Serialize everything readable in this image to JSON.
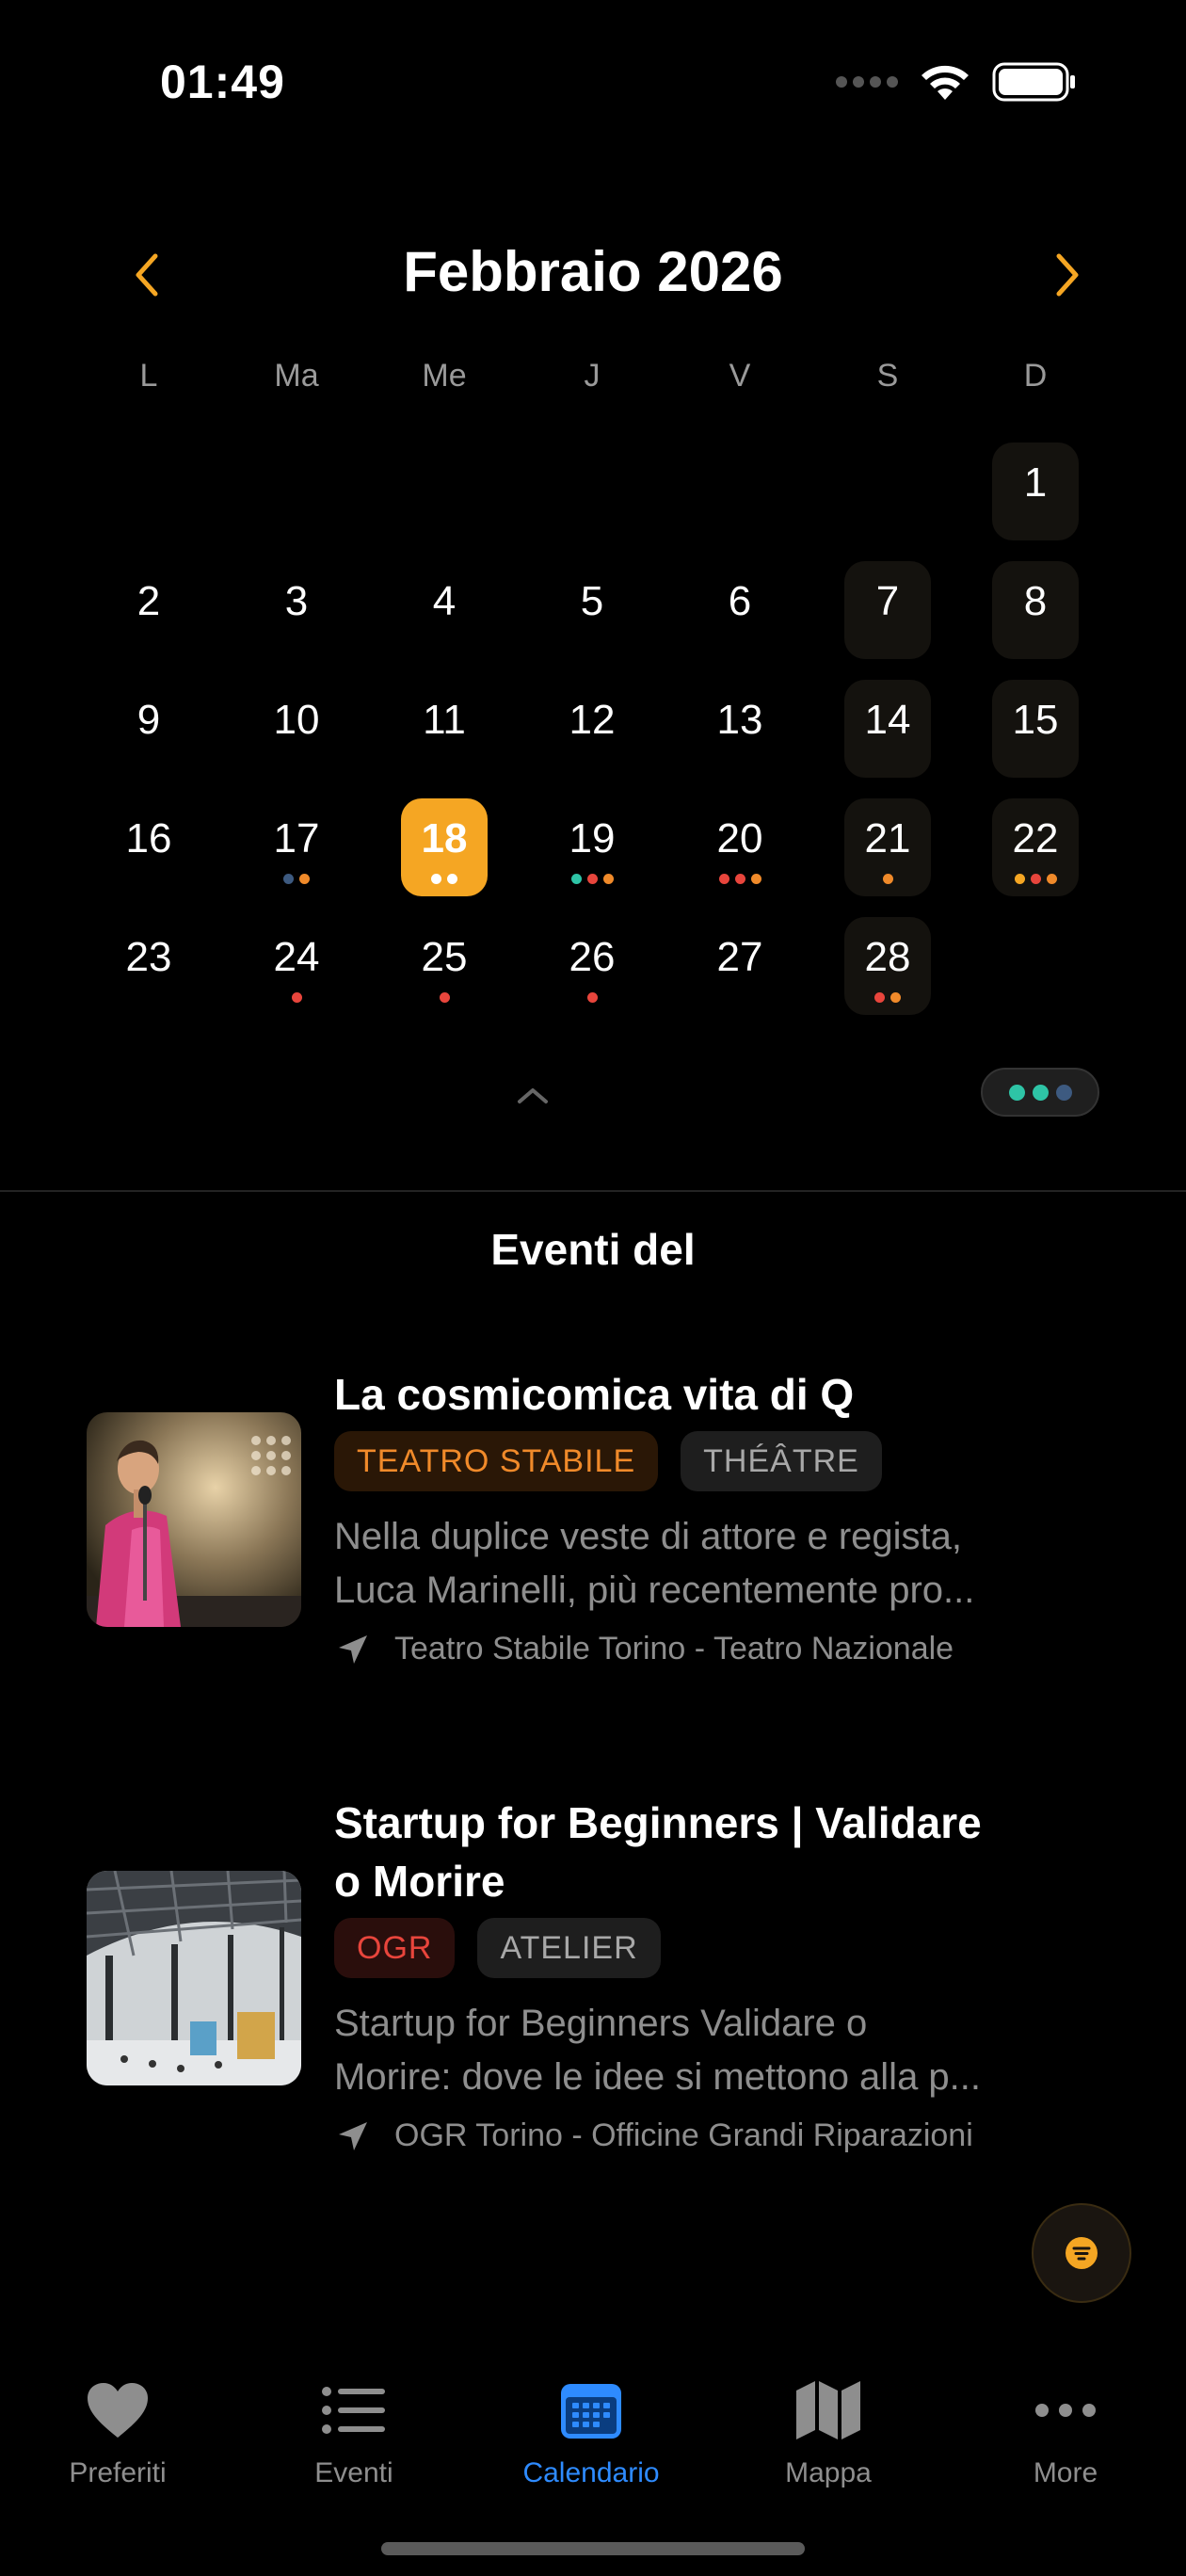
{
  "status_bar": {
    "time": "01:49"
  },
  "calendar": {
    "month_title": "Febbraio 2026",
    "weekdays": [
      "L",
      "Ma",
      "Me",
      "J",
      "V",
      "S",
      "D"
    ],
    "selected_day": "18",
    "days": {
      "d1": "1",
      "d2": "2",
      "d3": "3",
      "d4": "4",
      "d5": "5",
      "d6": "6",
      "d7": "7",
      "d8": "8",
      "d9": "9",
      "d10": "10",
      "d11": "11",
      "d12": "12",
      "d13": "13",
      "d14": "14",
      "d15": "15",
      "d16": "16",
      "d17": "17",
      "d18": "18",
      "d19": "19",
      "d20": "20",
      "d21": "21",
      "d22": "22",
      "d23": "23",
      "d24": "24",
      "d25": "25",
      "d26": "26",
      "d27": "27",
      "d28": "28"
    },
    "colors": {
      "accent": "#f5a623",
      "teal": "#2ec4a6",
      "red": "#e8453c",
      "orange": "#f08a2a",
      "blue_grey": "#3d5a80"
    }
  },
  "events_section": {
    "title": "Eventi del",
    "events": [
      {
        "title": "La cosmicomica vita di Q",
        "venue_tag": "TEATRO STABILE",
        "category_tag": "THÉÂTRE",
        "description_line1": "Nella duplice veste di attore e regista,",
        "description_line2": "Luca Marinelli, più recentemente pro...",
        "location": "Teatro Stabile Torino - Teatro Nazionale"
      },
      {
        "title_line1": "Startup for Beginners | Validare",
        "title_line2": "o Morire",
        "venue_tag": "OGR",
        "category_tag": "ATELIER",
        "description_line1": "Startup for Beginners Validare o",
        "description_line2": "Morire: dove le idee si mettono alla p...",
        "location": "OGR Torino - Officine Grandi Riparazioni"
      }
    ]
  },
  "tabbar": {
    "tabs": [
      {
        "label": "Preferiti",
        "icon": "heart-icon"
      },
      {
        "label": "Eventi",
        "icon": "list-icon"
      },
      {
        "label": "Calendario",
        "icon": "calendar-icon",
        "active": true
      },
      {
        "label": "Mappa",
        "icon": "map-icon"
      },
      {
        "label": "More",
        "icon": "ellipsis-icon"
      }
    ]
  }
}
